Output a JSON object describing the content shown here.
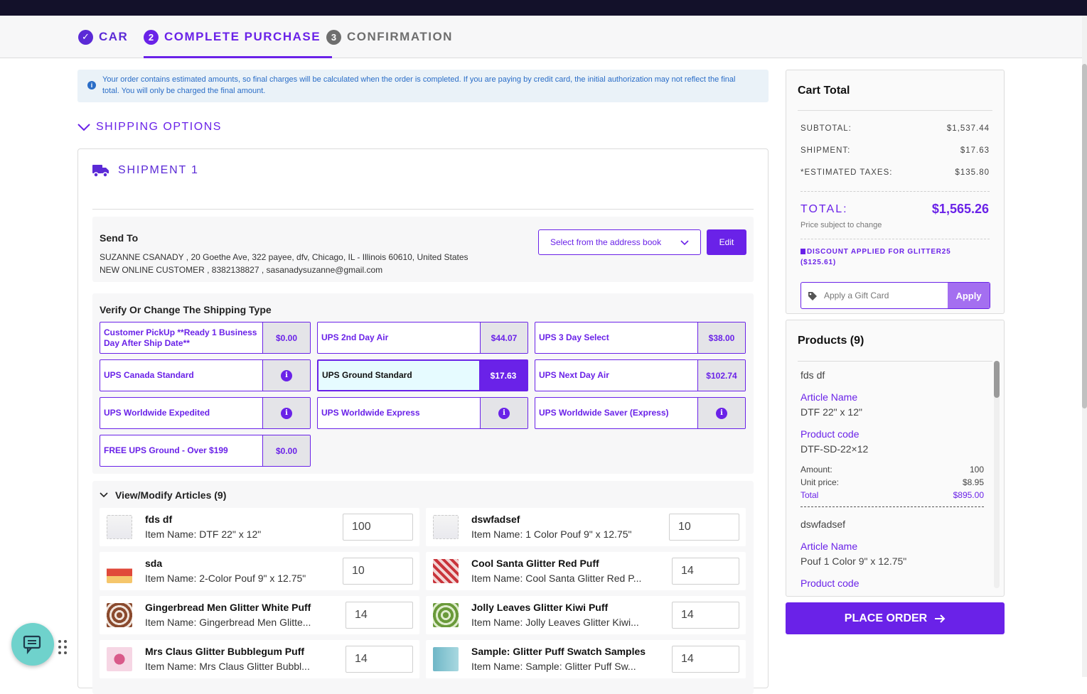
{
  "steps": [
    {
      "label": "CAR",
      "icon": "check-circle-icon"
    },
    {
      "label": "COMPLETE PURCHASE",
      "number": "2"
    },
    {
      "label": "CONFIRMATION",
      "number": "3"
    }
  ],
  "notice": "Your order contains estimated amounts, so final charges will be calculated when the order is completed. If you are paying by credit card, the initial authorization may not reflect the final total. You will only be charged the final amount.",
  "shipping_options_label": "SHIPPING OPTIONS",
  "shipment_label": "SHIPMENT 1",
  "send_to": {
    "heading": "Send To",
    "line1": "SUZANNE CSANADY , 20 Goethe Ave, 322 payee, dfv, Chicago, IL - Illinois 60610, United States",
    "line2": "NEW ONLINE CUSTOMER , 8382138827 , sasanadysuzanne@gmail.com",
    "address_book": "Select from the address book",
    "edit": "Edit"
  },
  "shipping_type": {
    "heading": "Verify Or Change The Shipping Type",
    "options": [
      {
        "label": "Customer PickUp **Ready 1 Business Day After Ship Date**",
        "price": "$0.00"
      },
      {
        "label": "UPS 2nd Day Air",
        "price": "$44.07"
      },
      {
        "label": "UPS 3 Day Select",
        "price": "$38.00"
      },
      {
        "label": "UPS Canada Standard",
        "price": ""
      },
      {
        "label": "UPS Ground Standard",
        "price": "$17.63",
        "selected": true
      },
      {
        "label": "UPS Next Day Air",
        "price": "$102.74"
      },
      {
        "label": "UPS Worldwide Expedited",
        "price": ""
      },
      {
        "label": "UPS Worldwide Express",
        "price": ""
      },
      {
        "label": "UPS Worldwide Saver (Express)",
        "price": ""
      },
      {
        "label": "FREE UPS Ground - Over $199",
        "price": "$0.00"
      }
    ]
  },
  "articles": {
    "heading": "View/Modify Articles (9)",
    "items": [
      {
        "name": "fds df",
        "item": "Item Name: DTF 22\" x 12\"",
        "qty": "100"
      },
      {
        "name": "dswfadsef",
        "item": "Item Name: 1 Color Pouf 9\" x 12.75\"",
        "qty": "10"
      },
      {
        "name": "sda",
        "item": "Item Name: 2-Color Pouf 9\" x 12.75\"",
        "qty": "10"
      },
      {
        "name": "Cool Santa Glitter Red Puff",
        "item": "Item Name: Cool Santa Glitter Red P...",
        "qty": "14"
      },
      {
        "name": "Gingerbread Men Glitter White Puff",
        "item": "Item Name: Gingerbread Men Glitte...",
        "qty": "14"
      },
      {
        "name": "Jolly Leaves Glitter Kiwi Puff",
        "item": "Item Name: Jolly Leaves Glitter Kiwi...",
        "qty": "14"
      },
      {
        "name": "Mrs Claus Glitter Bubblegum Puff",
        "item": "Item Name: Mrs Claus Glitter Bubbl...",
        "qty": "14"
      },
      {
        "name": "Sample: Glitter Puff Swatch Samples",
        "item": "Item Name: Sample: Glitter Puff Sw...",
        "qty": "14"
      }
    ]
  },
  "cart": {
    "title": "Cart Total",
    "subtotal_label": "SUBTOTAL:",
    "subtotal": "$1,537.44",
    "shipment_label": "SHIPMENT:",
    "shipment": "$17.63",
    "taxes_label": "*ESTIMATED TAXES:",
    "taxes": "$135.80",
    "total_label": "TOTAL:",
    "total": "$1,565.26",
    "subject": "Price subject to change",
    "discount": "DISCOUNT APPLIED FOR GLITTER25",
    "discount_amount": "($125.61)",
    "gift_placeholder": "Apply a Gift Card",
    "apply": "Apply"
  },
  "products": {
    "title": "Products (9)",
    "first": {
      "name": "fds df",
      "article_label": "Article Name",
      "article": "DTF 22\" x 12\"",
      "code_label": "Product code",
      "code": "DTF-SD-22×12",
      "amount_label": "Amount:",
      "amount": "100",
      "unit_label": "Unit price:",
      "unit": "$8.95",
      "total_label": "Total",
      "total": "$895.00"
    },
    "second": {
      "name": "dswfadsef",
      "article_label": "Article Name",
      "article": "Pouf 1 Color 9\" x 12.75\"",
      "code_label": "Product code"
    }
  },
  "place_order": "PLACE ORDER",
  "colors": {
    "accent": "#6a22e8",
    "selected_bg": "#e6fbff",
    "chat": "#6fd2cc",
    "topbar": "#13112a"
  }
}
